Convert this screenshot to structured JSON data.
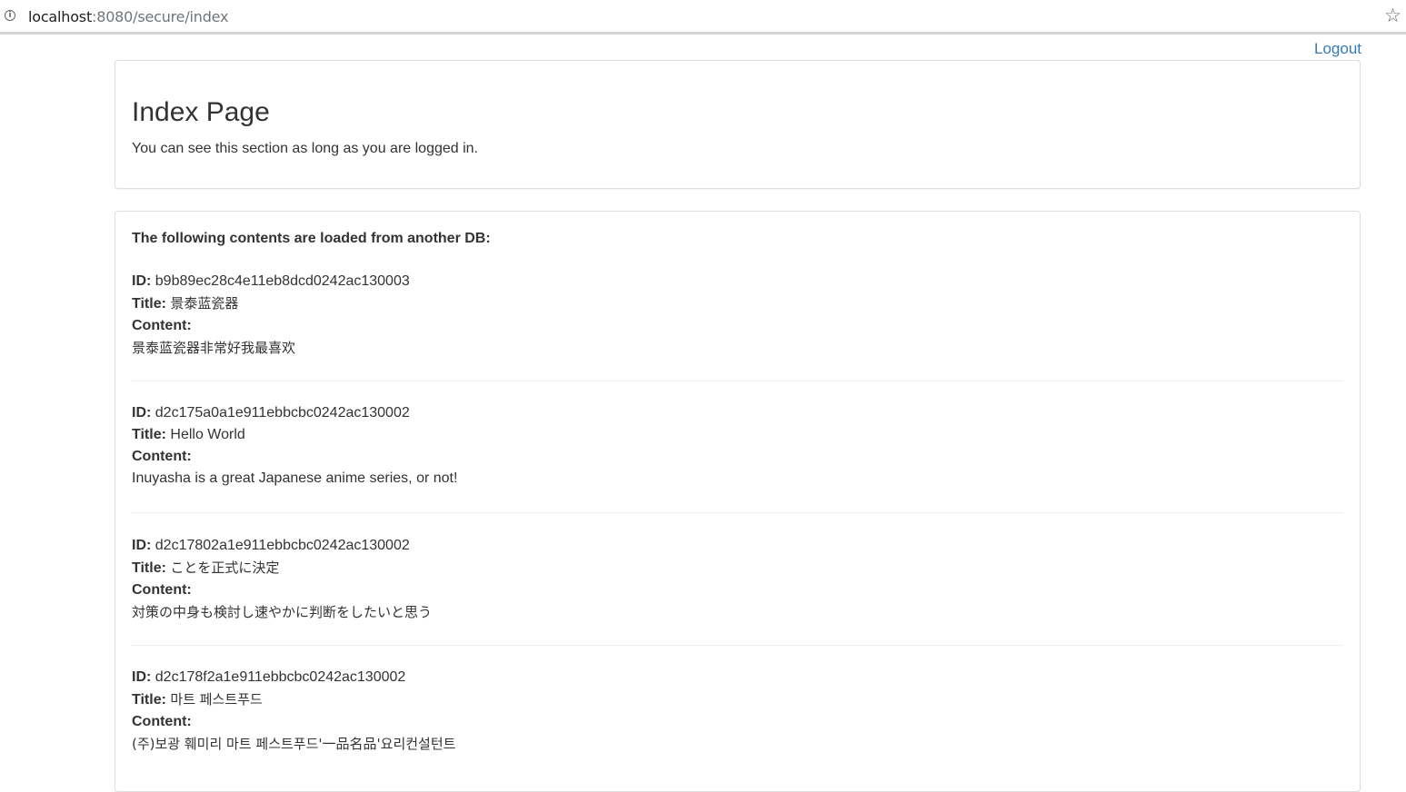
{
  "browser": {
    "url_host": "localhost",
    "url_rest": ":8080/secure/index"
  },
  "nav": {
    "logout_label": "Logout"
  },
  "header": {
    "title": "Index Page",
    "subtitle": "You can see this section as long as you are logged in."
  },
  "main": {
    "heading": "The following contents are loaded from another DB:",
    "id_label": "ID:",
    "title_label": "Title:",
    "content_label": "Content:",
    "entries": [
      {
        "id": "b9b89ec28c4e11eb8dcd0242ac130003",
        "title": "景泰蓝瓷器",
        "content": "景泰蓝瓷器非常好我最喜欢"
      },
      {
        "id": "d2c175a0a1e911ebbcbc0242ac130002",
        "title": "Hello World",
        "content": "Inuyasha is a great Japanese anime series, or not!"
      },
      {
        "id": "d2c17802a1e911ebbcbc0242ac130002",
        "title": "ことを正式に決定",
        "content": "対策の中身も検討し速やかに判断をしたいと思う"
      },
      {
        "id": "d2c178f2a1e911ebbcbc0242ac130002",
        "title": "마트 페스트푸드",
        "content": "(주)보광 훼미리 마트 페스트푸드'一品名品'요리컨설턴트"
      }
    ]
  }
}
